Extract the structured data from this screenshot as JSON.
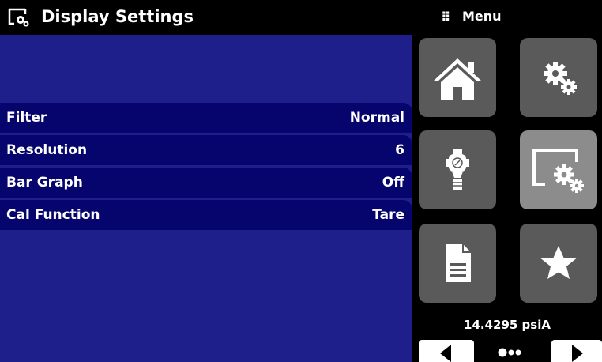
{
  "header": {
    "title": "Display Settings",
    "title_icon": "display-settings-icon"
  },
  "menu": {
    "label": "Menu",
    "grip_glyph": "⠿"
  },
  "settings": [
    {
      "label": "Filter",
      "value": "Normal"
    },
    {
      "label": "Resolution",
      "value": "6"
    },
    {
      "label": "Bar Graph",
      "value": "Off"
    },
    {
      "label": "Cal Function",
      "value": "Tare"
    }
  ],
  "tiles": [
    {
      "name": "home",
      "icon": "home-icon",
      "active": false
    },
    {
      "name": "settings",
      "icon": "gears-icon",
      "active": false
    },
    {
      "name": "sensor",
      "icon": "pressure-sensor-icon",
      "active": false
    },
    {
      "name": "display-settings",
      "icon": "display-settings-icon",
      "active": true
    },
    {
      "name": "document",
      "icon": "document-icon",
      "active": false
    },
    {
      "name": "favorites",
      "icon": "star-icon",
      "active": false
    }
  ],
  "status": {
    "pressure": "14.4295 psiA"
  },
  "pager": {
    "pages": 3,
    "current": 1
  },
  "colors": {
    "background": "#000000",
    "main_panel": "#1f1f8c",
    "row": "#05056d",
    "tile": "#5a5a5a",
    "tile_active": "#8c8c8c",
    "text": "#ffffff"
  }
}
